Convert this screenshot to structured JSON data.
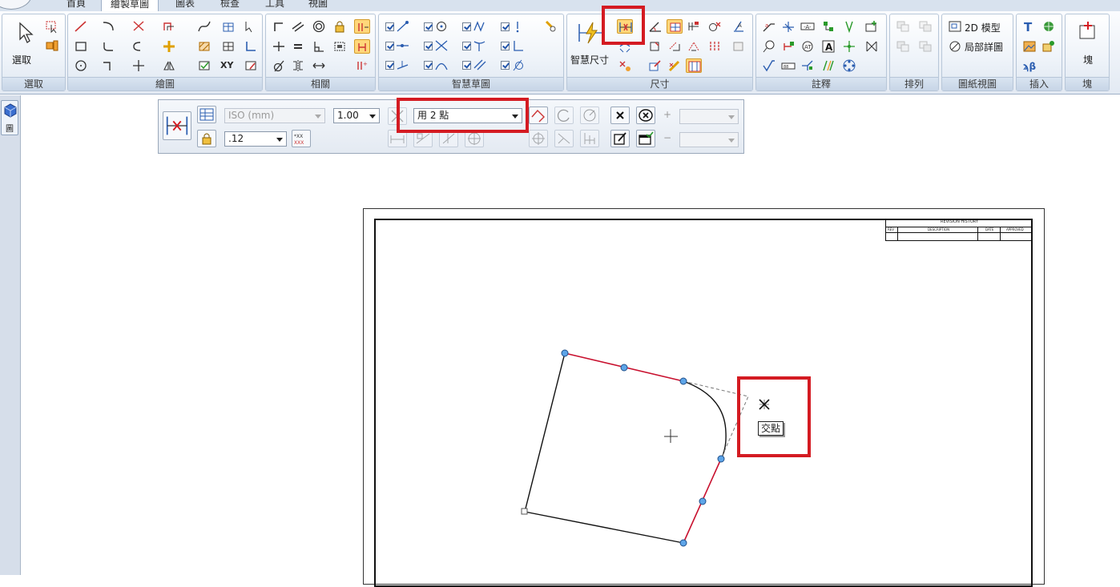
{
  "tabs": [
    "首頁",
    "繪製草圖",
    "圖表",
    "檢查",
    "工具",
    "視圖"
  ],
  "active_tab": "繪製草圖",
  "ribbon": {
    "groups": {
      "select": "選取",
      "draw": "繪圖",
      "relate": "相關",
      "intellisketch": "智慧草圖",
      "dimension": "尺寸",
      "annotation": "註釋",
      "arrange": "排列",
      "drawing_views": "圖紙視圖",
      "insert": "插入",
      "block": "塊"
    },
    "select_label": "選取",
    "smart_dimension_label": "智慧尺寸",
    "model_2d_label": "2D 模型",
    "detail_view_label": "局部詳圖",
    "block_label": "塊",
    "xy_label": "XY"
  },
  "pathfinder_tab_label": "圖",
  "command_bar": {
    "dim_style": "ISO (mm)",
    "scale": "1.00",
    "precision": ".12",
    "mode": "用 2 點",
    "plus_sign": "+",
    "minus_sign": "−"
  },
  "sheet": {
    "revision_title": "REVISION HISTORY",
    "rev_cols": [
      "REV",
      "DESCRIPTION",
      "DATE",
      "APPROVED"
    ]
  },
  "tooltip": "交點",
  "colors": {
    "highlight_red": "#d41b22",
    "selected_edge": "#c8102e",
    "keypoint": "#5ea5e8",
    "active_button": "#ffd77a"
  }
}
